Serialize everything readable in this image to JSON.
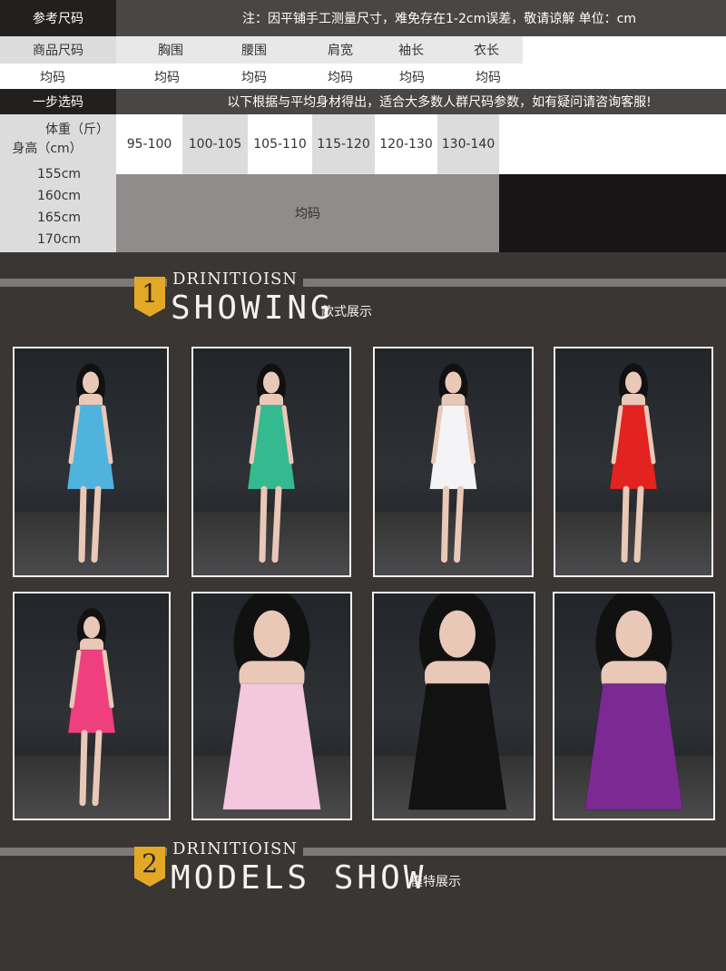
{
  "size_table": {
    "ref_label": "参考尺码",
    "notice": "注：因平铺手工测量尺寸，难免存在1-2cm误差，敬请谅解 单位：cm",
    "headers": [
      "商品尺码",
      "胸围",
      "腰围",
      "肩宽",
      "袖长",
      "衣长"
    ],
    "values": [
      "均码",
      "均码",
      "均码",
      "均码",
      "均码",
      "均码"
    ],
    "step_label": "一步选码",
    "step_notice": "以下根据与平均身材得出，适合大多数人群尺码参数，如有疑问请咨询客服!",
    "weight_label": "体重（斤）",
    "height_label": "身高（cm）",
    "weights": [
      "95-100",
      "100-105",
      "105-110",
      "115-120",
      "120-130",
      "130-140"
    ],
    "heights": [
      "155cm",
      "160cm",
      "165cm",
      "170cm"
    ],
    "fit_value": "均码"
  },
  "section1": {
    "number": "1",
    "eyebrow": "DRINITIOISN",
    "title": "SHOWING",
    "subtitle": "款式展示"
  },
  "section2": {
    "number": "2",
    "eyebrow": "DRINITIOISN",
    "title": "MODELS SHOW",
    "subtitle": "模特展示"
  },
  "photos": [
    {
      "dress_color": "#4fb3de"
    },
    {
      "dress_color": "#35b98e"
    },
    {
      "dress_color": "#f4f4f6"
    },
    {
      "dress_color": "#e2231f"
    },
    {
      "dress_color": "#ef3f7e"
    },
    {
      "dress_color": "#f3c8df"
    },
    {
      "dress_color": "#121212"
    },
    {
      "dress_color": "#7a2a92"
    }
  ],
  "colors": {
    "accent": "#e4a827",
    "background": "#3a3633"
  }
}
